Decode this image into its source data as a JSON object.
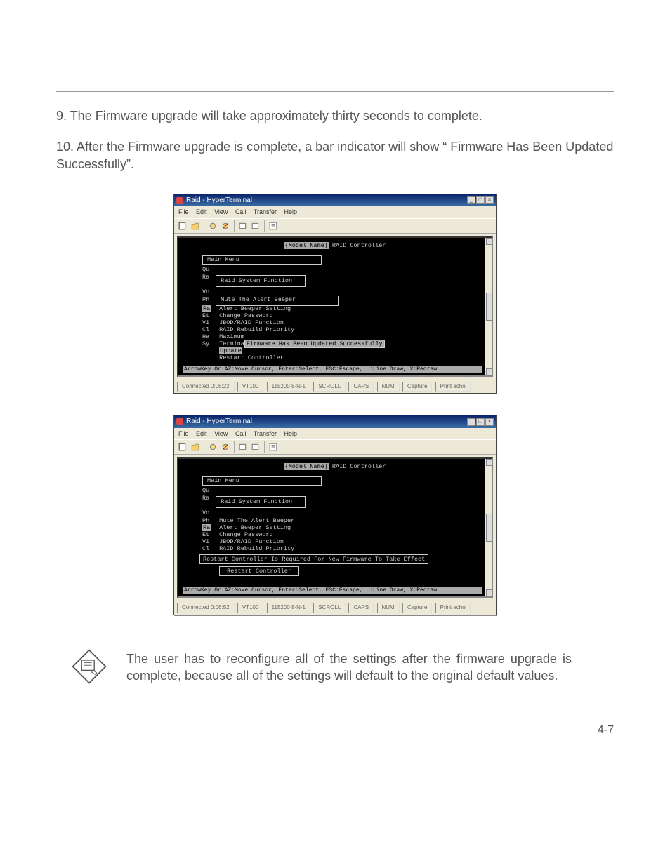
{
  "body": {
    "step9": "9. The Firmware upgrade will take approximately thirty seconds to complete.",
    "step10": "10. After the Firmware upgrade is complete, a bar indicator will show “ Firmware Has Been Updated Successfully”."
  },
  "ht": {
    "title": "Raid - HyperTerminal",
    "menu": {
      "file": "File",
      "edit": "Edit",
      "view": "View",
      "call": "Call",
      "transfer": "Transfer",
      "help": "Help"
    },
    "status": {
      "conn1": "Connected 0:06:22",
      "conn2": "Connected 0:06:52",
      "emul": "VT100",
      "baud": "115200 8-N-1",
      "scroll": "SCROLL",
      "caps": "CAPS",
      "num": "NUM",
      "capture": "Capture",
      "echo": "Print echo"
    }
  },
  "term": {
    "header_hl": "{Model Name}",
    "header_rest": " RAID Controller",
    "main_menu": "Main Menu",
    "stubs1": [
      "Qu",
      "Ra",
      "Vo",
      "Ph",
      "Ra",
      "Et",
      "Vi",
      "Cl",
      "Ha",
      "Sy"
    ],
    "stubs2": [
      "Qu",
      "Ra",
      "Vo",
      "Ph",
      "Ra",
      "Et",
      "Vi",
      "Cl"
    ],
    "rsf": "Raid System Function",
    "items": {
      "mute": "Mute The Alert Beeper",
      "abs": "Alert Beeper Setting",
      "cpw": "Change Password",
      "jbod": "JBOD/RAID Function",
      "rrp": "RAID Rebuild Priority",
      "max": "Maximum",
      "termina": "Termina",
      "update_hl": "Update ",
      "restart": "Restart Controller"
    },
    "msg1": "Firmware Has Been Updated Successfully",
    "msg2": "Restart Controller Is Required For New Firmware To Take Effect",
    "footer": "ArrowKey Or AZ:Move Cursor, Enter:Select, ESC:Escape, L:Line Draw, X:Redraw"
  },
  "note": {
    "text": "The user has to reconfigure all of the settings after the firmware upgrade is complete, because all of the settings will default to the original default values."
  },
  "page_num": "4-7"
}
